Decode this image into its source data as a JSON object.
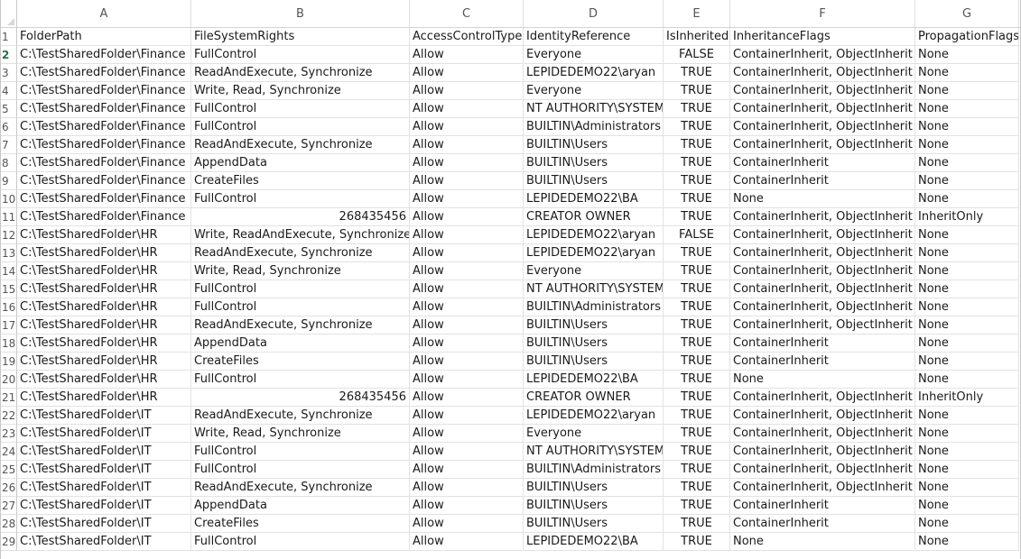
{
  "columns": [
    "A",
    "B",
    "C",
    "D",
    "E",
    "F",
    "G"
  ],
  "rows": [
    [
      "FolderPath",
      "FileSystemRights",
      "AccessControlType",
      "IdentityReference",
      "IsInherited",
      "InheritanceFlags",
      "PropagationFlags"
    ],
    [
      "C:\\TestSharedFolder\\Finance",
      "FullControl",
      "Allow",
      "Everyone",
      "FALSE",
      "ContainerInherit, ObjectInherit",
      "None"
    ],
    [
      "C:\\TestSharedFolder\\Finance",
      "ReadAndExecute, Synchronize",
      "Allow",
      "LEPIDEDEMO22\\aryan",
      "TRUE",
      "ContainerInherit, ObjectInherit",
      "None"
    ],
    [
      "C:\\TestSharedFolder\\Finance",
      "Write, Read, Synchronize",
      "Allow",
      "Everyone",
      "TRUE",
      "ContainerInherit, ObjectInherit",
      "None"
    ],
    [
      "C:\\TestSharedFolder\\Finance",
      "FullControl",
      "Allow",
      "NT AUTHORITY\\SYSTEM",
      "TRUE",
      "ContainerInherit, ObjectInherit",
      "None"
    ],
    [
      "C:\\TestSharedFolder\\Finance",
      "FullControl",
      "Allow",
      "BUILTIN\\Administrators",
      "TRUE",
      "ContainerInherit, ObjectInherit",
      "None"
    ],
    [
      "C:\\TestSharedFolder\\Finance",
      "ReadAndExecute, Synchronize",
      "Allow",
      "BUILTIN\\Users",
      "TRUE",
      "ContainerInherit, ObjectInherit",
      "None"
    ],
    [
      "C:\\TestSharedFolder\\Finance",
      "AppendData",
      "Allow",
      "BUILTIN\\Users",
      "TRUE",
      "ContainerInherit",
      "None"
    ],
    [
      "C:\\TestSharedFolder\\Finance",
      "CreateFiles",
      "Allow",
      "BUILTIN\\Users",
      "TRUE",
      "ContainerInherit",
      "None"
    ],
    [
      "C:\\TestSharedFolder\\Finance",
      "FullControl",
      "Allow",
      "LEPIDEDEMO22\\BA",
      "TRUE",
      "None",
      "None"
    ],
    [
      "C:\\TestSharedFolder\\Finance",
      "268435456",
      "Allow",
      "CREATOR OWNER",
      "TRUE",
      "ContainerInherit, ObjectInherit",
      "InheritOnly"
    ],
    [
      "C:\\TestSharedFolder\\HR",
      "Write, ReadAndExecute, Synchronize",
      "Allow",
      "LEPIDEDEMO22\\aryan",
      "FALSE",
      "ContainerInherit, ObjectInherit",
      "None"
    ],
    [
      "C:\\TestSharedFolder\\HR",
      "ReadAndExecute, Synchronize",
      "Allow",
      "LEPIDEDEMO22\\aryan",
      "TRUE",
      "ContainerInherit, ObjectInherit",
      "None"
    ],
    [
      "C:\\TestSharedFolder\\HR",
      "Write, Read, Synchronize",
      "Allow",
      "Everyone",
      "TRUE",
      "ContainerInherit, ObjectInherit",
      "None"
    ],
    [
      "C:\\TestSharedFolder\\HR",
      "FullControl",
      "Allow",
      "NT AUTHORITY\\SYSTEM",
      "TRUE",
      "ContainerInherit, ObjectInherit",
      "None"
    ],
    [
      "C:\\TestSharedFolder\\HR",
      "FullControl",
      "Allow",
      "BUILTIN\\Administrators",
      "TRUE",
      "ContainerInherit, ObjectInherit",
      "None"
    ],
    [
      "C:\\TestSharedFolder\\HR",
      "ReadAndExecute, Synchronize",
      "Allow",
      "BUILTIN\\Users",
      "TRUE",
      "ContainerInherit, ObjectInherit",
      "None"
    ],
    [
      "C:\\TestSharedFolder\\HR",
      "AppendData",
      "Allow",
      "BUILTIN\\Users",
      "TRUE",
      "ContainerInherit",
      "None"
    ],
    [
      "C:\\TestSharedFolder\\HR",
      "CreateFiles",
      "Allow",
      "BUILTIN\\Users",
      "TRUE",
      "ContainerInherit",
      "None"
    ],
    [
      "C:\\TestSharedFolder\\HR",
      "FullControl",
      "Allow",
      "LEPIDEDEMO22\\BA",
      "TRUE",
      "None",
      "None"
    ],
    [
      "C:\\TestSharedFolder\\HR",
      "268435456",
      "Allow",
      "CREATOR OWNER",
      "TRUE",
      "ContainerInherit, ObjectInherit",
      "InheritOnly"
    ],
    [
      "C:\\TestSharedFolder\\IT",
      "ReadAndExecute, Synchronize",
      "Allow",
      "LEPIDEDEMO22\\aryan",
      "TRUE",
      "ContainerInherit, ObjectInherit",
      "None"
    ],
    [
      "C:\\TestSharedFolder\\IT",
      "Write, Read, Synchronize",
      "Allow",
      "Everyone",
      "TRUE",
      "ContainerInherit, ObjectInherit",
      "None"
    ],
    [
      "C:\\TestSharedFolder\\IT",
      "FullControl",
      "Allow",
      "NT AUTHORITY\\SYSTEM",
      "TRUE",
      "ContainerInherit, ObjectInherit",
      "None"
    ],
    [
      "C:\\TestSharedFolder\\IT",
      "FullControl",
      "Allow",
      "BUILTIN\\Administrators",
      "TRUE",
      "ContainerInherit, ObjectInherit",
      "None"
    ],
    [
      "C:\\TestSharedFolder\\IT",
      "ReadAndExecute, Synchronize",
      "Allow",
      "BUILTIN\\Users",
      "TRUE",
      "ContainerInherit, ObjectInherit",
      "None"
    ],
    [
      "C:\\TestSharedFolder\\IT",
      "AppendData",
      "Allow",
      "BUILTIN\\Users",
      "TRUE",
      "ContainerInherit",
      "None"
    ],
    [
      "C:\\TestSharedFolder\\IT",
      "CreateFiles",
      "Allow",
      "BUILTIN\\Users",
      "TRUE",
      "ContainerInherit",
      "None"
    ],
    [
      "C:\\TestSharedFolder\\IT",
      "FullControl",
      "Allow",
      "LEPIDEDEMO22\\BA",
      "TRUE",
      "None",
      "None"
    ]
  ],
  "active_row": 2
}
